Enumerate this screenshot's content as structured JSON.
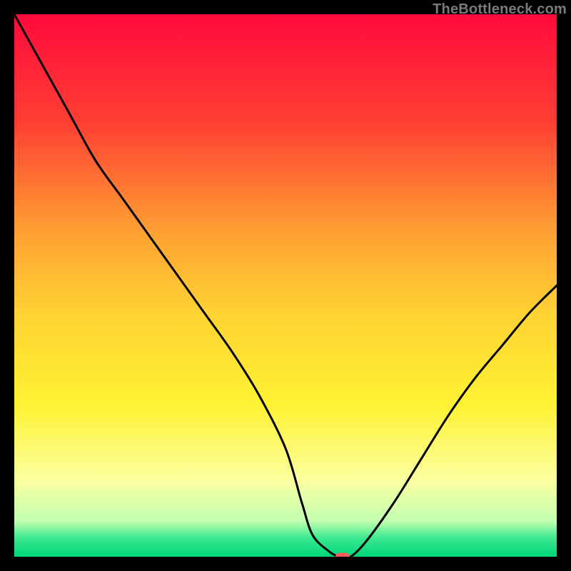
{
  "watermark": "TheBottleneck.com",
  "chart_data": {
    "type": "line",
    "title": "",
    "xlabel": "",
    "ylabel": "",
    "xlim": [
      0,
      100
    ],
    "ylim": [
      0,
      100
    ],
    "grid": false,
    "background_gradient_stops_top_to_bottom": [
      {
        "pos": 0.0,
        "color": "#ff0a3c"
      },
      {
        "pos": 0.2,
        "color": "#ff3f33"
      },
      {
        "pos": 0.4,
        "color": "#ffa033"
      },
      {
        "pos": 0.55,
        "color": "#ffd233"
      },
      {
        "pos": 0.72,
        "color": "#fff233"
      },
      {
        "pos": 0.86,
        "color": "#fbffa0"
      },
      {
        "pos": 0.935,
        "color": "#c0ffb0"
      },
      {
        "pos": 0.965,
        "color": "#3de890"
      },
      {
        "pos": 1.0,
        "color": "#00d67a"
      }
    ],
    "series": [
      {
        "name": "bottleneck-curve",
        "color": "#000000",
        "fill": false,
        "x": [
          0,
          5,
          10,
          15,
          20,
          25,
          30,
          35,
          40,
          45,
          50,
          53,
          55,
          58,
          60,
          62,
          65,
          70,
          75,
          80,
          85,
          90,
          95,
          100
        ],
        "y": [
          100,
          91,
          82,
          73,
          66,
          59,
          52,
          45,
          38,
          30,
          20,
          10,
          4,
          1,
          0,
          0,
          3,
          10,
          18,
          26,
          33,
          39,
          45,
          50
        ]
      }
    ],
    "markers": [
      {
        "name": "optimal-marker",
        "shape": "pill",
        "x": 60.5,
        "y": 0,
        "width_pct": 2.6,
        "height_pct": 1.4,
        "color": "#ff5a5a"
      }
    ]
  }
}
